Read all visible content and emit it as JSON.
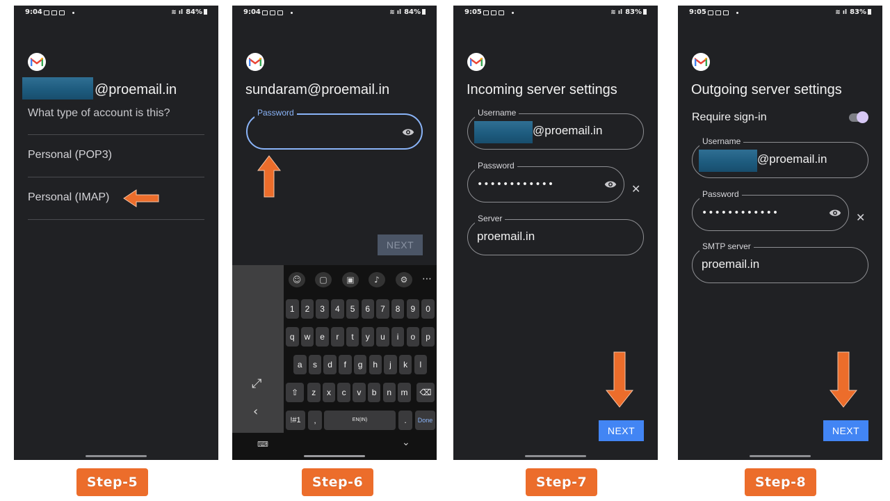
{
  "accent_colors": {
    "arrow": "#ec6d2b",
    "button": "#4285f4",
    "focus": "#8ab4f8",
    "background": "#202124"
  },
  "screens": [
    {
      "status": {
        "time": "9:04",
        "battery": "84%"
      },
      "email_suffix": "@proemail.in",
      "question": "What type of account is this?",
      "options": [
        "Personal (POP3)",
        "Personal (IMAP)"
      ],
      "step_label": "Step-5"
    },
    {
      "status": {
        "time": "9:04",
        "battery": "84%"
      },
      "title": "sundaram@proemail.in",
      "password_label": "Password",
      "next_label": "NEXT",
      "keyboard": {
        "numbers": [
          "1",
          "2",
          "3",
          "4",
          "5",
          "6",
          "7",
          "8",
          "9",
          "0"
        ],
        "row1": [
          "q",
          "w",
          "e",
          "r",
          "t",
          "y",
          "u",
          "i",
          "o",
          "p"
        ],
        "row2": [
          "a",
          "s",
          "d",
          "f",
          "g",
          "h",
          "j",
          "k",
          "l"
        ],
        "row3": [
          "z",
          "x",
          "c",
          "v",
          "b",
          "n",
          "m"
        ],
        "symbols": "!#1",
        "comma": ",",
        "space": "EN(IN)",
        "period": ".",
        "done": "Done"
      },
      "step_label": "Step-6"
    },
    {
      "status": {
        "time": "9:05",
        "battery": "83%"
      },
      "title": "Incoming server settings",
      "username_label": "Username",
      "username_suffix": "@proemail.in",
      "password_label": "Password",
      "password_value": "••••••••••••",
      "server_label": "Server",
      "server_value": "proemail.in",
      "next_label": "NEXT",
      "step_label": "Step-7"
    },
    {
      "status": {
        "time": "9:05",
        "battery": "83%"
      },
      "title": "Outgoing server settings",
      "require_signin": "Require sign-in",
      "require_signin_on": true,
      "username_label": "Username",
      "username_suffix": "@proemail.in",
      "password_label": "Password",
      "password_value": "••••••••••••",
      "server_label": "SMTP server",
      "server_value": "proemail.in",
      "next_label": "NEXT",
      "step_label": "Step-8"
    }
  ]
}
